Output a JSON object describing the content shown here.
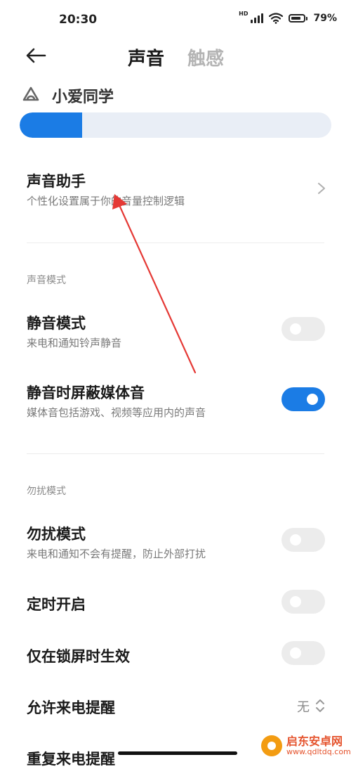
{
  "status_bar": {
    "time": "20:30",
    "network_badge": "HD",
    "battery": "79%",
    "battery_level": 0.79
  },
  "header": {
    "back_icon": "back-arrow-icon",
    "tabs": [
      {
        "label": "声音",
        "active": true
      },
      {
        "label": "触感",
        "active": false
      }
    ]
  },
  "xiaoai": {
    "icon": "xiaoai-logo-icon",
    "label": "小爱同学",
    "volume_level": 0.2
  },
  "sound_assistant": {
    "title": "声音助手",
    "subtitle": "个性化设置属于你的音量控制逻辑"
  },
  "sections": {
    "sound_mode": {
      "label": "声音模式",
      "items": [
        {
          "title": "静音模式",
          "subtitle": "来电和通知铃声静音",
          "on": false
        },
        {
          "title": "静音时屏蔽媒体音",
          "subtitle": "媒体音包括游戏、视频等应用内的声音",
          "on": true
        }
      ]
    },
    "dnd_mode": {
      "label": "勿扰模式",
      "items": [
        {
          "title": "勿扰模式",
          "subtitle": "来电和通知不会有提醒，防止外部打扰",
          "on": false
        },
        {
          "title": "定时开启",
          "on": false
        },
        {
          "title": "仅在锁屏时生效",
          "on": false
        }
      ],
      "allow_calls": {
        "title": "允许来电提醒",
        "value": "无"
      },
      "repeat_calls": {
        "title": "重复来电提醒"
      }
    }
  },
  "watermark": {
    "name": "启东安卓网",
    "url": "www.qdltdq.com"
  },
  "colors": {
    "accent": "#1b7ce5",
    "annotation_arrow": "#e53935",
    "toggle_off": "#ececec"
  }
}
